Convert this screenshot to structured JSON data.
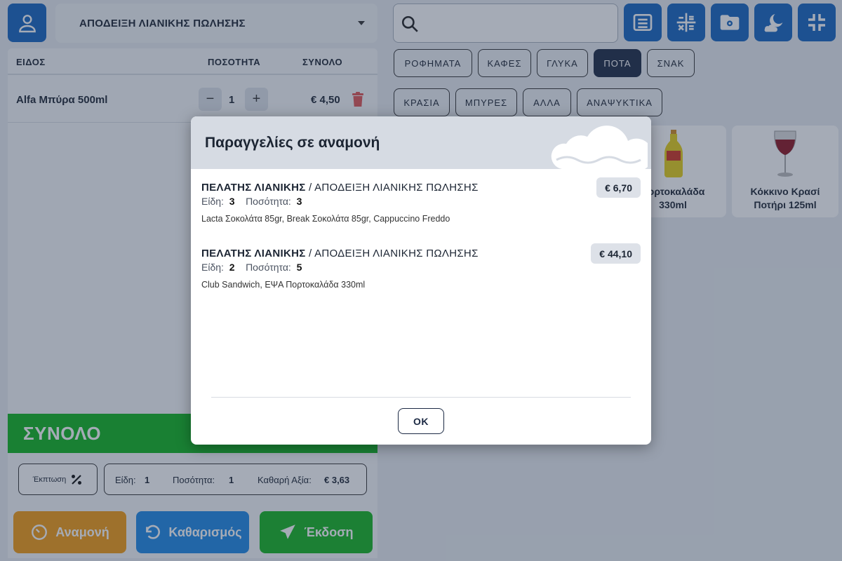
{
  "header": {
    "receipt_type": "ΑΠΟΔΕΙΞΗ ΛΙΑΝΙΚΗΣ ΠΩΛΗΣΗΣ"
  },
  "order": {
    "columns": {
      "item": "ΕΙΔΟΣ",
      "quantity": "ΠΟΣΟΤΗΤΑ",
      "total": "ΣΥΝΟΛΟ"
    },
    "rows": [
      {
        "name": "Alfa Μπύρα 500ml",
        "minus": "−",
        "qty": "1",
        "plus": "+",
        "total": "€ 4,50"
      }
    ],
    "total_label": "ΣΥΝΟΛΟ"
  },
  "summary": {
    "discount_label": "Έκπτωση",
    "items_label": "Είδη:",
    "items_value": "1",
    "qty_label": "Ποσότητα:",
    "qty_value": "1",
    "net_label": "Καθαρή Αξία:",
    "net_value": "€ 3,63"
  },
  "actions": {
    "hold": "Αναμονή",
    "clear": "Καθαρισμός",
    "issue": "Έκδοση"
  },
  "search": {
    "placeholder": ""
  },
  "categories": {
    "row1": [
      "ΡΟΦΗΜΑΤΑ",
      "ΚΑΦΕΣ",
      "ΓΛΥΚΑ",
      "ΠΟΤΑ",
      "ΣΝΑΚ"
    ],
    "row2": [
      "ΚΡΑΣΙΑ",
      "ΜΠΥΡΕΣ",
      "ΑΛΛΑ",
      "ΑΝΑΨΥΚΤΙΚΑ"
    ],
    "active": "ΠΟΤΑ"
  },
  "products": [
    {
      "name_line1": "Πορτοκαλάδα",
      "name_line2": "330ml"
    },
    {
      "name_line1": "Κόκκινο Κρασί",
      "name_line2": "Ποτήρι 125ml"
    }
  ],
  "modal": {
    "title": "Παραγγελίες σε αναμονή",
    "orders": [
      {
        "customer": "ΠΕΛΑΤΗΣ ΛΙΑΝΙΚΗΣ",
        "separator": " / ",
        "receipt": "ΑΠΟΔΕΙΞΗ ΛΙΑΝΙΚΗΣ ΠΩΛΗΣΗΣ",
        "items_label": "Είδη:",
        "items_value": "3",
        "qty_label": "Ποσότητα:",
        "qty_value": "3",
        "items_list": "Lacta Σοκολάτα 85gr, Break Σοκολάτα 85gr, Cappuccino Freddo",
        "price": "€ 6,70"
      },
      {
        "customer": "ΠΕΛΑΤΗΣ ΛΙΑΝΙΚΗΣ",
        "separator": " / ",
        "receipt": "ΑΠΟΔΕΙΞΗ ΛΙΑΝΙΚΗΣ ΠΩΛΗΣΗΣ",
        "items_label": "Είδη:",
        "items_value": "2",
        "qty_label": "Ποσότητα:",
        "qty_value": "5",
        "items_list": "Club Sandwich, ΕΨΑ Πορτοκαλάδα 330ml",
        "price": "€ 44,10"
      }
    ],
    "ok": "ΟΚ"
  },
  "colors": {
    "primary_blue": "#1565c0",
    "total_green": "#0fb51e",
    "hold_orange": "#f39c12",
    "clear_blue": "#1e88e5",
    "issue_green": "#13b51f",
    "active_category": "#1c2a44"
  },
  "icons": [
    "user-icon",
    "chevron-down-icon",
    "search-icon",
    "receipt-icon",
    "calculator-icon",
    "folder-settings-icon",
    "weather-night-icon",
    "collapse-icon",
    "trash-icon",
    "percent-icon",
    "timer-icon",
    "undo-icon",
    "send-icon",
    "cloud-icon"
  ]
}
